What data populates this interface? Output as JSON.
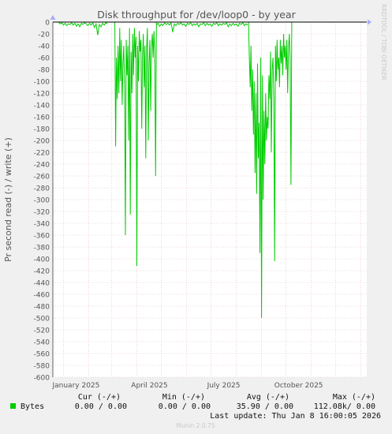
{
  "chart_data": {
    "type": "line",
    "title": "Disk throughput for /dev/loop0 - by year",
    "ylabel": "Pr second read (-) / write (+)",
    "side_label": "RRDTOOL / TOBI OETIKER",
    "ylim": [
      -600,
      0
    ],
    "yticks": [
      0,
      -20,
      -40,
      -60,
      -80,
      -100,
      -120,
      -140,
      -160,
      -180,
      -200,
      -220,
      -240,
      -260,
      -280,
      -300,
      -320,
      -340,
      -360,
      -380,
      -400,
      -420,
      -440,
      -460,
      -480,
      -500,
      -520,
      -540,
      -560,
      -580,
      -600
    ],
    "x_labels": [
      "January 2025",
      "April 2025",
      "July 2025",
      "October 2025"
    ],
    "grid": true,
    "series": [
      {
        "name": "Bytes",
        "color": "#00cc00",
        "segments": [
          [
            [
              "2024-12-26",
              0
            ],
            [
              "2024-12-28",
              -3
            ],
            [
              "2024-12-30",
              -1
            ],
            [
              "2025-01-01",
              -5
            ],
            [
              "2025-01-03",
              -2
            ],
            [
              "2025-01-05",
              -6
            ],
            [
              "2025-01-07",
              -3
            ],
            [
              "2025-01-09",
              -4
            ],
            [
              "2025-01-11",
              -1
            ],
            [
              "2025-01-13",
              -5
            ],
            [
              "2025-01-15",
              -2
            ],
            [
              "2025-01-17",
              -7
            ],
            [
              "2025-01-19",
              -3
            ],
            [
              "2025-01-21",
              -8
            ],
            [
              "2025-01-23",
              -2
            ],
            [
              "2025-01-25",
              -4
            ],
            [
              "2025-01-27",
              -1
            ],
            [
              "2025-01-29",
              -3
            ],
            [
              "2025-01-31",
              -6
            ],
            [
              "2025-02-02",
              -2
            ],
            [
              "2025-02-04",
              -5
            ],
            [
              "2025-02-06",
              -1
            ],
            [
              "2025-02-08",
              -9
            ],
            [
              "2025-02-10",
              -3
            ],
            [
              "2025-02-12",
              -22
            ],
            [
              "2025-02-14",
              -4
            ],
            [
              "2025-02-16",
              -8
            ],
            [
              "2025-02-18",
              -2
            ],
            [
              "2025-02-20",
              -5
            ],
            [
              "2025-02-22",
              -1
            ],
            [
              "2025-02-24",
              -3
            ]
          ],
          [
            [
              "2025-03-05",
              0
            ],
            [
              "2025-03-06",
              -210
            ],
            [
              "2025-03-07",
              -60
            ],
            [
              "2025-03-08",
              -130
            ],
            [
              "2025-03-09",
              -40
            ],
            [
              "2025-03-10",
              -120
            ],
            [
              "2025-03-11",
              -10
            ],
            [
              "2025-03-12",
              -100
            ],
            [
              "2025-03-13",
              -30
            ],
            [
              "2025-03-14",
              -140
            ],
            [
              "2025-03-15",
              -70
            ],
            [
              "2025-03-16",
              -40
            ],
            [
              "2025-03-17",
              -110
            ],
            [
              "2025-03-18",
              -360
            ],
            [
              "2025-03-19",
              -30
            ],
            [
              "2025-03-20",
              -90
            ],
            [
              "2025-03-21",
              -40
            ],
            [
              "2025-03-22",
              -200
            ],
            [
              "2025-03-23",
              -10
            ],
            [
              "2025-03-24",
              -325
            ],
            [
              "2025-03-25",
              -50
            ],
            [
              "2025-03-26",
              -120
            ],
            [
              "2025-03-27",
              -20
            ],
            [
              "2025-03-28",
              -90
            ],
            [
              "2025-03-29",
              -10
            ],
            [
              "2025-03-30",
              -60
            ],
            [
              "2025-03-31",
              -25
            ],
            [
              "2025-04-01",
              -412
            ],
            [
              "2025-04-02",
              -40
            ],
            [
              "2025-04-03",
              -100
            ],
            [
              "2025-04-04",
              -15
            ],
            [
              "2025-04-05",
              -50
            ],
            [
              "2025-04-06",
              -30
            ],
            [
              "2025-04-07",
              -180
            ],
            [
              "2025-04-08",
              -60
            ],
            [
              "2025-04-09",
              -20
            ],
            [
              "2025-04-10",
              -110
            ],
            [
              "2025-04-11",
              -40
            ],
            [
              "2025-04-12",
              -230
            ],
            [
              "2025-04-13",
              -45
            ],
            [
              "2025-04-14",
              -10
            ],
            [
              "2025-04-15",
              -200
            ],
            [
              "2025-04-16",
              -70
            ],
            [
              "2025-04-17",
              -30
            ],
            [
              "2025-04-18",
              -150
            ],
            [
              "2025-04-19",
              -40
            ],
            [
              "2025-04-20",
              -20
            ],
            [
              "2025-04-21",
              -60
            ],
            [
              "2025-04-22",
              -15
            ],
            [
              "2025-04-23",
              -50
            ],
            [
              "2025-04-24",
              -260
            ],
            [
              "2025-04-25",
              0
            ]
          ],
          [
            [
              "2025-04-25",
              -5
            ],
            [
              "2025-04-27",
              -2
            ],
            [
              "2025-04-29",
              -7
            ],
            [
              "2025-05-01",
              -3
            ],
            [
              "2025-05-03",
              -6
            ],
            [
              "2025-05-05",
              -1
            ],
            [
              "2025-05-07",
              -4
            ],
            [
              "2025-05-09",
              -2
            ],
            [
              "2025-05-11",
              -5
            ],
            [
              "2025-05-13",
              -1
            ],
            [
              "2025-05-15",
              -17
            ],
            [
              "2025-05-17",
              -3
            ],
            [
              "2025-05-19",
              -6
            ],
            [
              "2025-05-21",
              -2
            ],
            [
              "2025-05-23",
              -4
            ],
            [
              "2025-05-25",
              -1
            ],
            [
              "2025-05-27",
              -5
            ],
            [
              "2025-05-29",
              -3
            ],
            [
              "2025-05-31",
              -7
            ],
            [
              "2025-06-02",
              -2
            ],
            [
              "2025-06-04",
              -4
            ],
            [
              "2025-06-06",
              -1
            ],
            [
              "2025-06-08",
              -6
            ],
            [
              "2025-06-10",
              -3
            ],
            [
              "2025-06-12",
              -5
            ],
            [
              "2025-06-14",
              -2
            ],
            [
              "2025-06-16",
              -8
            ],
            [
              "2025-06-18",
              -3
            ],
            [
              "2025-06-20",
              -4
            ],
            [
              "2025-06-22",
              -1
            ],
            [
              "2025-06-24",
              -6
            ],
            [
              "2025-06-26",
              -2
            ],
            [
              "2025-06-28",
              -5
            ],
            [
              "2025-06-30",
              -3
            ],
            [
              "2025-07-02",
              -7
            ],
            [
              "2025-07-04",
              -2
            ],
            [
              "2025-07-06",
              -4
            ],
            [
              "2025-07-08",
              -1
            ],
            [
              "2025-07-10",
              -6
            ],
            [
              "2025-07-12",
              -3
            ],
            [
              "2025-07-14",
              -5
            ],
            [
              "2025-07-16",
              -2
            ],
            [
              "2025-07-18",
              -4
            ],
            [
              "2025-07-20",
              -1
            ],
            [
              "2025-07-22",
              -8
            ],
            [
              "2025-07-24",
              -3
            ],
            [
              "2025-07-26",
              -6
            ],
            [
              "2025-07-28",
              -2
            ],
            [
              "2025-07-30",
              -5
            ],
            [
              "2025-08-01",
              -3
            ],
            [
              "2025-08-03",
              -7
            ],
            [
              "2025-08-05",
              -2
            ],
            [
              "2025-08-07",
              -4
            ],
            [
              "2025-08-09",
              -1
            ],
            [
              "2025-08-11",
              -6
            ],
            [
              "2025-08-13",
              -3
            ],
            [
              "2025-08-15",
              -5
            ]
          ],
          [
            [
              "2025-08-16",
              0
            ],
            [
              "2025-08-17",
              -60
            ],
            [
              "2025-08-18",
              -110
            ],
            [
              "2025-08-19",
              -40
            ],
            [
              "2025-08-20",
              -150
            ],
            [
              "2025-08-21",
              -80
            ],
            [
              "2025-08-22",
              -190
            ],
            [
              "2025-08-23",
              -100
            ],
            [
              "2025-08-24",
              -255
            ],
            [
              "2025-08-25",
              -120
            ],
            [
              "2025-08-26",
              -290
            ],
            [
              "2025-08-27",
              -70
            ],
            [
              "2025-08-28",
              -230
            ],
            [
              "2025-08-29",
              -170
            ],
            [
              "2025-08-30",
              -390
            ],
            [
              "2025-08-31",
              -60
            ],
            [
              "2025-09-01",
              -500
            ],
            [
              "2025-09-02",
              -90
            ],
            [
              "2025-09-03",
              -300
            ],
            [
              "2025-09-04",
              -150
            ],
            [
              "2025-09-05",
              -240
            ],
            [
              "2025-09-06",
              -120
            ],
            [
              "2025-09-07",
              -200
            ],
            [
              "2025-09-08",
              -160
            ],
            [
              "2025-09-09",
              -180
            ],
            [
              "2025-09-10",
              -90
            ],
            [
              "2025-09-11",
              -130
            ],
            [
              "2025-09-12",
              -50
            ],
            [
              "2025-09-13",
              -220
            ],
            [
              "2025-09-14",
              -80
            ],
            [
              "2025-09-15",
              -60
            ],
            [
              "2025-09-16",
              -130
            ],
            [
              "2025-09-17",
              -404
            ],
            [
              "2025-09-18",
              -40
            ],
            [
              "2025-09-19",
              -100
            ],
            [
              "2025-09-20",
              -30
            ],
            [
              "2025-09-21",
              -80
            ],
            [
              "2025-09-22",
              -60
            ],
            [
              "2025-09-23",
              -110
            ],
            [
              "2025-09-24",
              -30
            ],
            [
              "2025-09-25",
              -70
            ],
            [
              "2025-09-26",
              -40
            ],
            [
              "2025-09-27",
              -90
            ],
            [
              "2025-09-28",
              -20
            ],
            [
              "2025-09-29",
              -60
            ],
            [
              "2025-09-30",
              -40
            ],
            [
              "2025-10-01",
              -80
            ],
            [
              "2025-10-02",
              -30
            ],
            [
              "2025-10-03",
              -120
            ],
            [
              "2025-10-04",
              -45
            ],
            [
              "2025-10-05",
              -20
            ],
            [
              "2025-10-06",
              -60
            ],
            [
              "2025-10-07",
              -275
            ],
            [
              "2025-10-08",
              0
            ]
          ]
        ]
      }
    ]
  },
  "legend": {
    "headers": {
      "cur": "Cur (-/+)",
      "min": "Min (-/+)",
      "avg": "Avg (-/+)",
      "max": "Max (-/+)"
    },
    "rows": [
      {
        "label": "Bytes",
        "color": "#00cc00",
        "cur": "0.00 /  0.00",
        "min": "0.00 /  0.00",
        "avg": "35.90 /  0.00",
        "max": "112.08k/  0.00"
      }
    ]
  },
  "footer": {
    "last_update": "Last update: Thu Jan  8 16:00:05 2026",
    "version": "Munin 2.0.75"
  }
}
